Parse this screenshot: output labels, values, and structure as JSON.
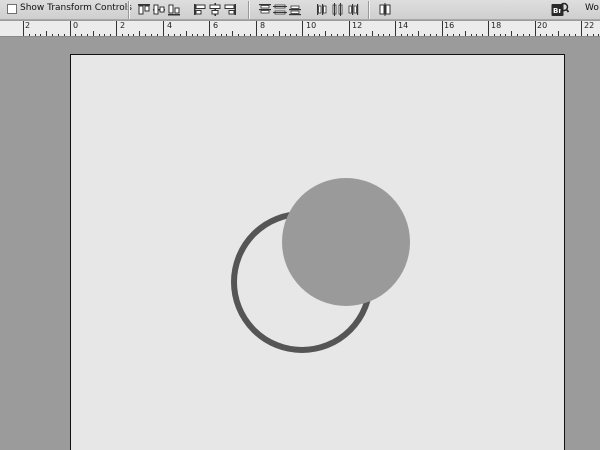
{
  "options_bar": {
    "show_transform_label": "Show Transform Controls",
    "show_transform_checked": false,
    "align_buttons": [
      {
        "name": "align-top-edges-icon"
      },
      {
        "name": "align-vertical-centers-icon"
      },
      {
        "name": "align-bottom-edges-icon"
      },
      {
        "name": "align-left-edges-icon"
      },
      {
        "name": "align-horizontal-centers-icon"
      },
      {
        "name": "align-right-edges-icon"
      }
    ],
    "distribute_buttons": [
      {
        "name": "distribute-top-edges-icon"
      },
      {
        "name": "distribute-vertical-centers-icon"
      },
      {
        "name": "distribute-bottom-edges-icon"
      },
      {
        "name": "distribute-left-edges-icon"
      },
      {
        "name": "distribute-horizontal-centers-icon"
      },
      {
        "name": "distribute-right-edges-icon"
      }
    ],
    "auto_align_icon": "auto-align-layers-icon",
    "bridge_icon": "launch-bridge-icon",
    "workspace_label": "Wo"
  },
  "ruler": {
    "labels": [
      "2",
      "0",
      "2",
      "4",
      "6",
      "8",
      "10",
      "12",
      "14",
      "16",
      "18",
      "20",
      "22"
    ]
  },
  "document": {
    "shapes": [
      {
        "name": "ring-shape",
        "kind": "ring",
        "color": "#555555"
      },
      {
        "name": "filled-circle-shape",
        "kind": "disc",
        "color": "#9a9a9a"
      }
    ]
  },
  "colors": {
    "workspace": "#9b9b9b",
    "canvas": "#e7e7e7",
    "ruler": "#ececec",
    "toolbar": "#d6d6d6"
  }
}
